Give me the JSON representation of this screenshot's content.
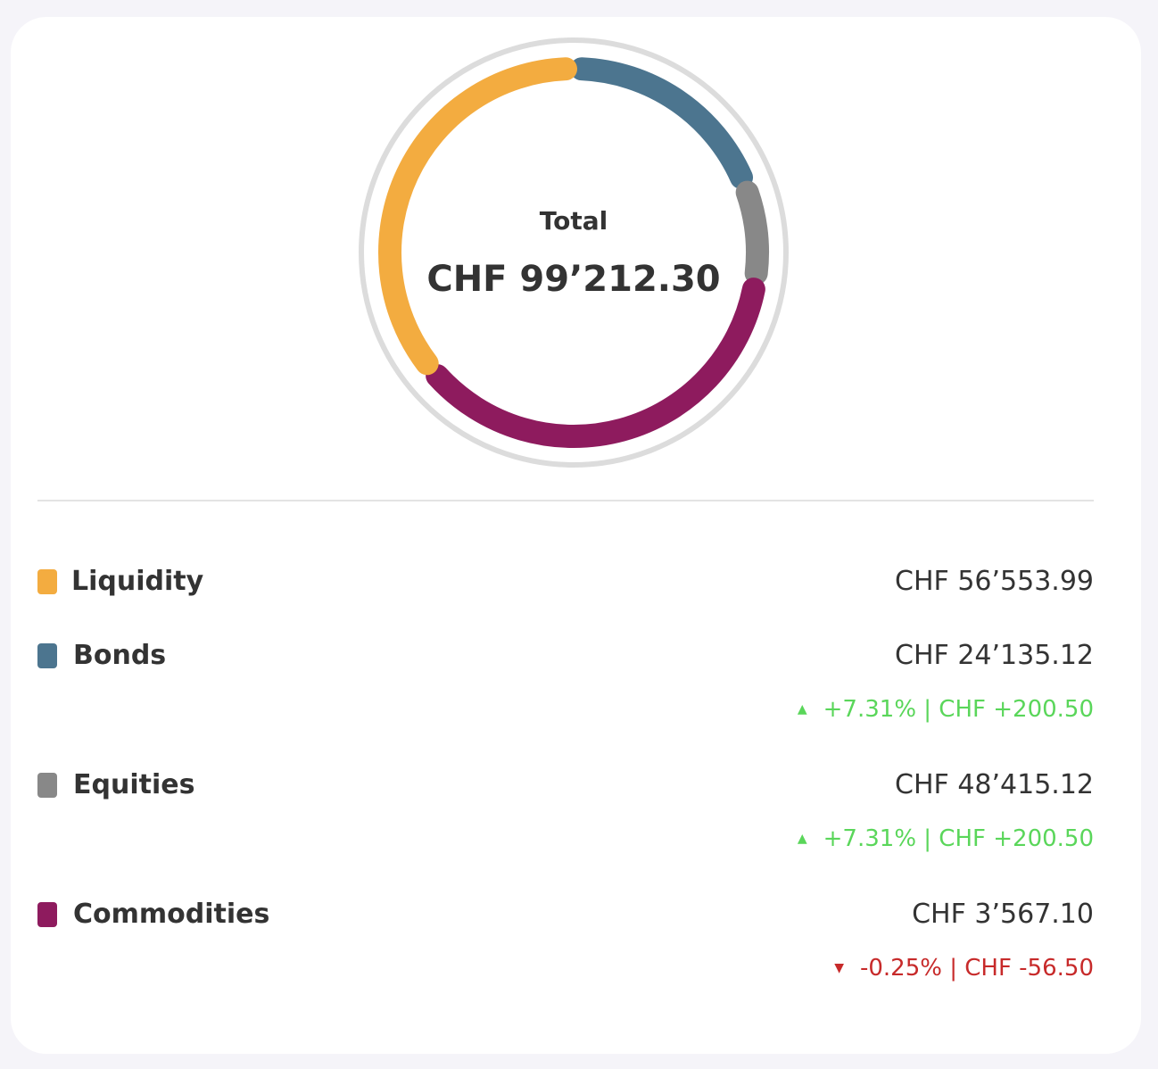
{
  "chart_data": {
    "type": "donut",
    "title": "Total",
    "total_label": "CHF 99’212.30",
    "currency": "CHF",
    "series": [
      {
        "name": "Liquidity",
        "value": 56553.99,
        "value_label": "CHF 56’553.99",
        "color": "#f3ac40",
        "change": null
      },
      {
        "name": "Bonds",
        "value": 24135.12,
        "value_label": "CHF 24’135.12",
        "color": "#4c758f",
        "change": {
          "direction": "up",
          "label": "+7.31% | CHF +200.50"
        }
      },
      {
        "name": "Equities",
        "value": 48415.12,
        "value_label": "CHF 48’415.12",
        "color": "#888888",
        "change": {
          "direction": "up",
          "label": "+7.31% | CHF +200.50"
        }
      },
      {
        "name": "Commodities",
        "value": 3567.1,
        "value_label": "CHF 3’567.10",
        "color": "#8e1b5e",
        "change": {
          "direction": "down",
          "label": "-0.25% | CHF -56.50"
        }
      }
    ],
    "ring_segments": [
      {
        "name": "Bonds",
        "fraction": 0.19
      },
      {
        "name": "Equities",
        "fraction": 0.085
      },
      {
        "name": "Commodities",
        "fraction": 0.365
      },
      {
        "name": "Liquidity",
        "fraction": 0.36
      }
    ],
    "colors": {
      "track": "#dcdcdc",
      "up": "#5ad65a",
      "down": "#c72a2a"
    }
  }
}
